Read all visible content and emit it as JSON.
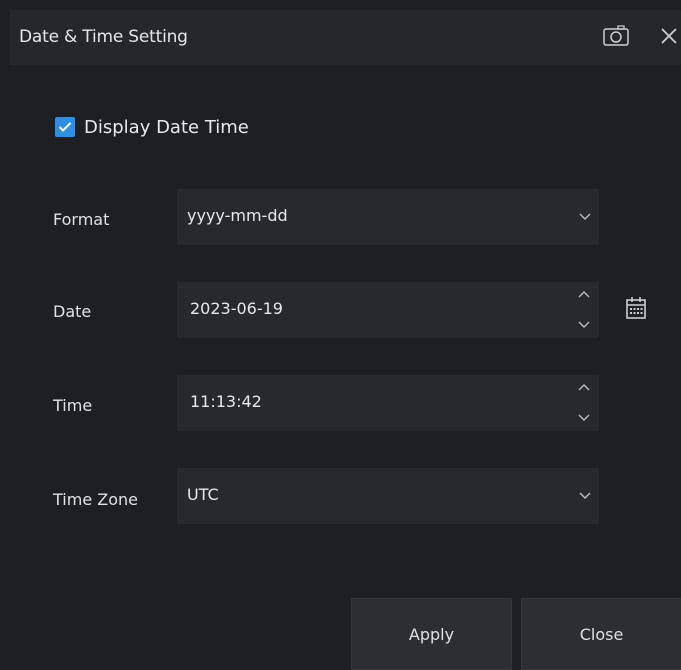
{
  "dialog": {
    "title": "Date & Time Setting",
    "camera_icon": "camera-icon",
    "close_icon": "close-icon"
  },
  "display_date_time": {
    "label": "Display Date Time",
    "checked": true
  },
  "fields": {
    "format": {
      "label": "Format",
      "value": "yyyy-mm-dd"
    },
    "date": {
      "label": "Date",
      "value": "2023-06-19"
    },
    "time": {
      "label": "Time",
      "value": "11:13:42"
    },
    "timezone": {
      "label": "Time Zone",
      "value": "UTC"
    }
  },
  "buttons": {
    "apply": "Apply",
    "close": "Close"
  },
  "colors": {
    "accent": "#2d8ee6",
    "background": "#1c2024",
    "field": "#262a2e"
  }
}
